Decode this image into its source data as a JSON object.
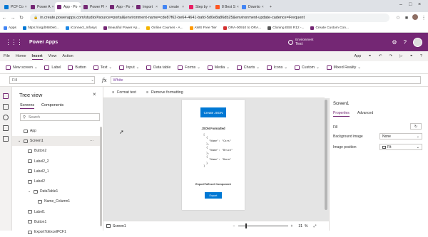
{
  "browser": {
    "tabs": [
      {
        "label": "PCF Co",
        "color": "#0078d4"
      },
      {
        "label": "Power A",
        "color": "#742774"
      },
      {
        "label": "App - Po",
        "color": "#742774"
      },
      {
        "label": "Power Pl",
        "color": "#742774"
      },
      {
        "label": "App - Po",
        "color": "#742774"
      },
      {
        "label": "Import",
        "color": "#742774"
      },
      {
        "label": "create",
        "color": "#4285f4"
      },
      {
        "label": "Step by",
        "color": "#e91e63"
      },
      {
        "label": "8 Best S",
        "color": "#ff5722"
      },
      {
        "label": "Downlo",
        "color": "#4285f4"
      }
    ],
    "url": "in.create.powerapps.com/studio/#source=portal&environment-name=cde87f62-be64-4641-bafd-5d0e8a86db25&environment-update-cadence=Frequent",
    "bookmarks": [
      {
        "label": "Apps",
        "color": "#4285f4"
      },
      {
        "label": "https://orgd0680e0...",
        "color": "#0078d4"
      },
      {
        "label": "iConnect_Infosys",
        "color": "#1e88e5"
      },
      {
        "label": "Beautiful Power Ap...",
        "color": "#742774"
      },
      {
        "label": "Online Courses - A...",
        "color": "#f4b400"
      },
      {
        "label": "AWS Free Tier",
        "color": "#ff9900"
      },
      {
        "label": "ORA-00910 to ORA...",
        "color": "#d32f2f"
      },
      {
        "label": "Cloning EBS R12 -...",
        "color": "#555555"
      },
      {
        "label": "Create Custom Con...",
        "color": "#742774"
      }
    ]
  },
  "app": {
    "title": "Power Apps",
    "environment_label": "Environment",
    "environment_name": "Test",
    "menu": [
      "File",
      "Home",
      "Insert",
      "View",
      "Action"
    ],
    "menu_selected": "Insert",
    "app_label": "App"
  },
  "toolbar": {
    "items": [
      "New screen",
      "Label",
      "Button",
      "Text",
      "Input",
      "Data table",
      "Forms",
      "Media",
      "Charts",
      "Icons",
      "Custom",
      "Mixed Reality"
    ]
  },
  "formula": {
    "property": "Fill",
    "fx": "fx",
    "value": "White"
  },
  "format": {
    "format_text": "Format text",
    "remove_formatting": "Remove formatting"
  },
  "tree": {
    "title": "Tree view",
    "tabs": [
      "Screens",
      "Components"
    ],
    "search_placeholder": "Search",
    "items": [
      {
        "label": "App",
        "indent": 0
      },
      {
        "label": "Screen1",
        "indent": 0
      },
      {
        "label": "Button2",
        "indent": 1
      },
      {
        "label": "Label2_2",
        "indent": 1
      },
      {
        "label": "Label2_1",
        "indent": 1
      },
      {
        "label": "Label2",
        "indent": 1
      },
      {
        "label": "DataTable1",
        "indent": 1
      },
      {
        "label": "Name_Column1",
        "indent": 2
      },
      {
        "label": "Label1",
        "indent": 1
      },
      {
        "label": "Button1",
        "indent": 1
      },
      {
        "label": "ExportToExcelPCF1",
        "indent": 1
      }
    ]
  },
  "canvas": {
    "create_json_button": "Create JSON",
    "json_formatted_label": "JSON Formatted",
    "json_lines": [
      "[",
      "{",
      "\"Name\": \"Cars\"",
      "},",
      "{",
      "\"Name\": \"Bruce\"",
      "},",
      "{",
      "\"Name\": \"Dana\"",
      "}",
      "]"
    ],
    "export_label": "ExportToExcel Component",
    "export_button": "Export"
  },
  "status": {
    "screen_name": "Screen1",
    "zoom": "31",
    "zoom_unit": "%"
  },
  "properties": {
    "screen_name": "Screen1",
    "tabs": [
      "Properties",
      "Advanced"
    ],
    "rows": [
      {
        "label": "Fill",
        "value": ""
      },
      {
        "label": "Background image",
        "value": "None"
      },
      {
        "label": "Image position",
        "value": "Fit"
      }
    ]
  }
}
